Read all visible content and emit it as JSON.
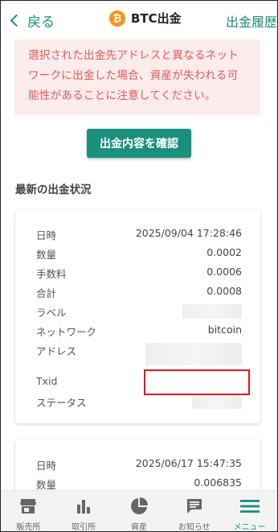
{
  "header": {
    "back_label": "戻る",
    "title": "BTC出金",
    "coin_symbol": "₿",
    "history_label": "出金履歴"
  },
  "warning": {
    "line1": "選択された出金先アドレスと異なるネット",
    "line2": "ワークに出金した場合、資産が失われる可",
    "line3": "能性があることに注意してください。"
  },
  "confirm_button": "出金内容を確認",
  "section_title": "最新の出金状況",
  "withdrawals": [
    {
      "datetime_label": "日時",
      "datetime": "2025/09/04 17:28:46",
      "amount_label": "数量",
      "amount": "0.0002",
      "fee_label": "手数料",
      "fee": "0.0006",
      "total_label": "合計",
      "total": "0.0008",
      "tag_label": "ラベル",
      "network_label": "ネットワーク",
      "network": "bitcoin",
      "address_label": "アドレス",
      "txid_label": "Txid",
      "status_label": "ステータス"
    },
    {
      "datetime_label": "日時",
      "datetime": "2025/06/17 15:47:35",
      "amount_label": "数量",
      "amount": "0.006835"
    }
  ],
  "nav": [
    {
      "label": "販売所",
      "icon": "store-icon"
    },
    {
      "label": "取引所",
      "icon": "bar-chart-icon"
    },
    {
      "label": "資産",
      "icon": "pie-chart-icon"
    },
    {
      "label": "お知らせ",
      "icon": "message-icon"
    },
    {
      "label": "メニュー",
      "icon": "menu-icon"
    }
  ],
  "colors": {
    "accent": "#1a8f7d",
    "warning_text": "#e05a5a",
    "warning_bg": "#fdecec",
    "bitcoin": "#f7931a",
    "highlight": "#e0141e"
  }
}
